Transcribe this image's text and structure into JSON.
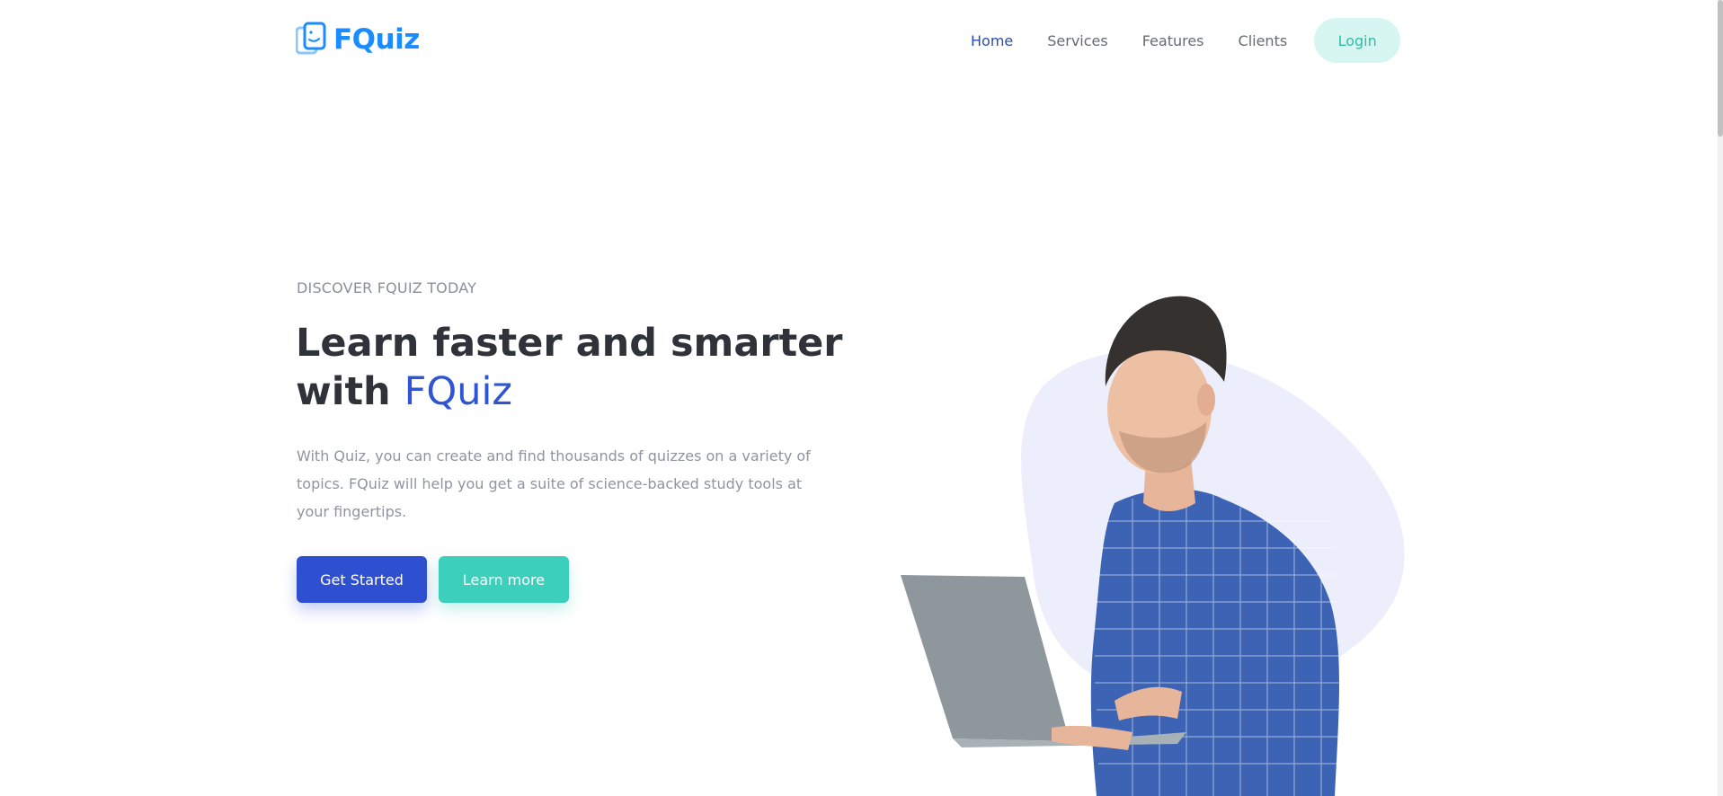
{
  "header": {
    "logo_text": "FQuiz",
    "nav": [
      {
        "label": "Home",
        "active": true
      },
      {
        "label": "Services",
        "active": false
      },
      {
        "label": "Features",
        "active": false
      },
      {
        "label": "Clients",
        "active": false
      }
    ],
    "login_label": "Login"
  },
  "hero": {
    "eyebrow": "DISCOVER FQUIZ TODAY",
    "headline_part1": "Learn faster and smarter",
    "headline_part2": "with ",
    "headline_brand": "FQuiz",
    "description": "With Quiz, you can create and find thousands of quizzes on a variety of topics. FQuiz will help you get a suite of science-backed study tools at your fingertips.",
    "primary_button": "Get Started",
    "secondary_button": "Learn more",
    "image_icon": "man-with-laptop-illustration"
  },
  "colors": {
    "brand_blue": "#1a8cff",
    "primary": "#2f4fd1",
    "accent_teal": "#3ccfbb",
    "login_bg": "#d8f6f1",
    "heading": "#2f3339",
    "body_text": "#8f959d",
    "blob": "#eceefc"
  }
}
